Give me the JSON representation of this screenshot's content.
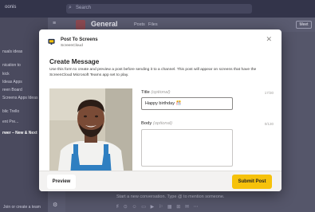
{
  "background": {
    "app_name": "oonis",
    "search_placeholder": "Search",
    "sidebar": {
      "items": [
        {
          "label": "nuals ideas"
        },
        {
          "label": "nication to"
        },
        {
          "label": "kick"
        },
        {
          "label": "Ideas Apps"
        },
        {
          "label": "reen Board"
        },
        {
          "label": "Screens Apps Ideas"
        },
        {
          "label": "blic Trello"
        },
        {
          "label": "ent Pre..."
        },
        {
          "label": "rwer – New & Next"
        }
      ],
      "bottom_label": "Join or create a team"
    },
    "channel": {
      "title": "General",
      "tabs": [
        "Posts",
        "Files"
      ],
      "meet_label": "Meet"
    },
    "compose": {
      "placeholder": "Start a new conversation. Type @ to mention someone."
    }
  },
  "modal": {
    "app_title": "Post To Screens",
    "app_subtitle": "ScreenCloud",
    "form_title": "Create Message",
    "form_description": "Use this form to create and preview a post before sending it to a channel. This post will appear on screens that have the ScreenCloud Microsoft Teams app set to play.",
    "title_field": {
      "label": "Title",
      "optional": "(optional)",
      "counter": "17/30",
      "value": "Happy birthday 🎊"
    },
    "body_field": {
      "label": "Body",
      "optional": "(optional)",
      "counter": "0/130",
      "value": ""
    },
    "preview_label": "Preview",
    "submit_label": "Submit Post"
  },
  "colors": {
    "accent": "#f6c20b",
    "teams_dark": "#33344a"
  },
  "icons": {
    "close": "close-icon",
    "logo": "screencloud-logo-icon",
    "search": "search-icon"
  }
}
